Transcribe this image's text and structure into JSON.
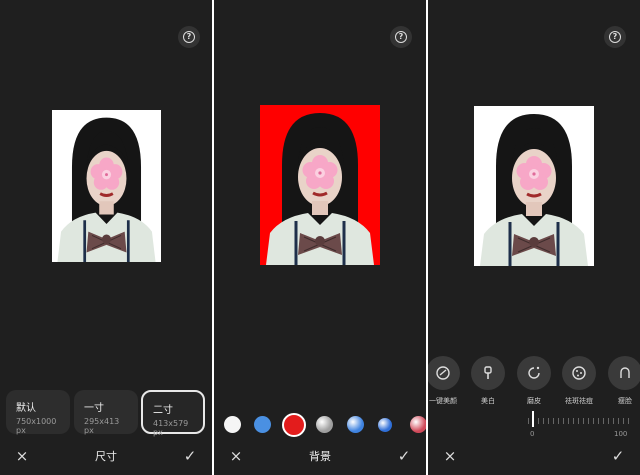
{
  "panels": [
    {
      "title": "尺寸",
      "bg_color": "#ffffff",
      "sizes": [
        {
          "name": "默认",
          "dims": "750x1000 px"
        },
        {
          "name": "一寸",
          "dims": "295x413 px"
        },
        {
          "name": "二寸",
          "dims": "413x579 px",
          "selected": true
        }
      ]
    },
    {
      "title": "背景",
      "bg_color": "#ff0000",
      "swatches": [
        {
          "color": "#f5f5f5",
          "name": "white"
        },
        {
          "color": "#4a90e2",
          "name": "blue"
        },
        {
          "color": "#e31c1c",
          "name": "red",
          "selected": true
        },
        {
          "color": "#9e9e9e",
          "name": "gray-gradient"
        },
        {
          "color": "#3f83e0",
          "name": "blue-gradient"
        },
        {
          "color": "#2f6fd8",
          "name": "blue-gradient-2"
        },
        {
          "color": "#d14a5a",
          "name": "red-gradient"
        }
      ]
    },
    {
      "bg_color": "#ffffff",
      "tools": [
        {
          "label": "一键美颜",
          "icon": "face-sparkle-icon"
        },
        {
          "label": "美白",
          "icon": "brush-icon"
        },
        {
          "label": "磨皮",
          "icon": "smooth-icon"
        },
        {
          "label": "祛斑祛痘",
          "icon": "spot-icon"
        },
        {
          "label": "瘦脸",
          "icon": "slim-face-icon"
        }
      ],
      "slider": {
        "min": "0",
        "max": "100",
        "value": 0
      }
    }
  ],
  "icons": {
    "close": "×",
    "confirm": "✓",
    "help": "?"
  }
}
